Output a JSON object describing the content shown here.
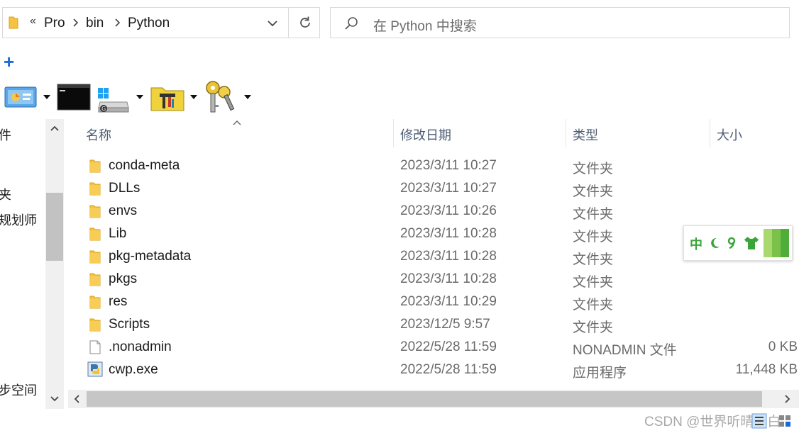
{
  "address_bar": {
    "overflow": "«",
    "crumbs": [
      "Pro",
      "bin",
      "Python"
    ]
  },
  "search": {
    "placeholder": "在 Python 中搜索"
  },
  "toolbar": {
    "add_label": "+"
  },
  "nav": {
    "items": [
      "件",
      "夹",
      "规划师",
      "步空间"
    ]
  },
  "columns": {
    "name": "名称",
    "date": "修改日期",
    "type": "类型",
    "size": "大小"
  },
  "files": [
    {
      "name": "conda-meta",
      "date": "2023/3/11 10:27",
      "type": "文件夹",
      "size": "",
      "icon": "folder-icon"
    },
    {
      "name": "DLLs",
      "date": "2023/3/11 10:27",
      "type": "文件夹",
      "size": "",
      "icon": "folder-icon"
    },
    {
      "name": "envs",
      "date": "2023/3/11 10:26",
      "type": "文件夹",
      "size": "",
      "icon": "folder-icon"
    },
    {
      "name": "Lib",
      "date": "2023/3/11 10:28",
      "type": "文件夹",
      "size": "",
      "icon": "folder-icon"
    },
    {
      "name": "pkg-metadata",
      "date": "2023/3/11 10:28",
      "type": "文件夹",
      "size": "",
      "icon": "folder-icon"
    },
    {
      "name": "pkgs",
      "date": "2023/3/11 10:28",
      "type": "文件夹",
      "size": "",
      "icon": "folder-icon"
    },
    {
      "name": "res",
      "date": "2023/3/11 10:29",
      "type": "文件夹",
      "size": "",
      "icon": "folder-icon"
    },
    {
      "name": "Scripts",
      "date": "2023/12/5 9:57",
      "type": "文件夹",
      "size": "",
      "icon": "folder-icon"
    },
    {
      "name": ".nonadmin",
      "date": "2022/5/28 11:59",
      "type": "NONADMIN 文件",
      "size": "0 KB",
      "icon": "file-icon"
    },
    {
      "name": "cwp.exe",
      "date": "2022/5/28 11:59",
      "type": "应用程序",
      "size": "11,448 KB",
      "icon": "python-exe-icon"
    }
  ],
  "ime": {
    "mode": "中"
  },
  "watermark": "CSDN @世界听晴明白",
  "colors": {
    "folder": "#f5c242",
    "accent": "#1a6bd3",
    "ime_green": "#3aa53a"
  }
}
